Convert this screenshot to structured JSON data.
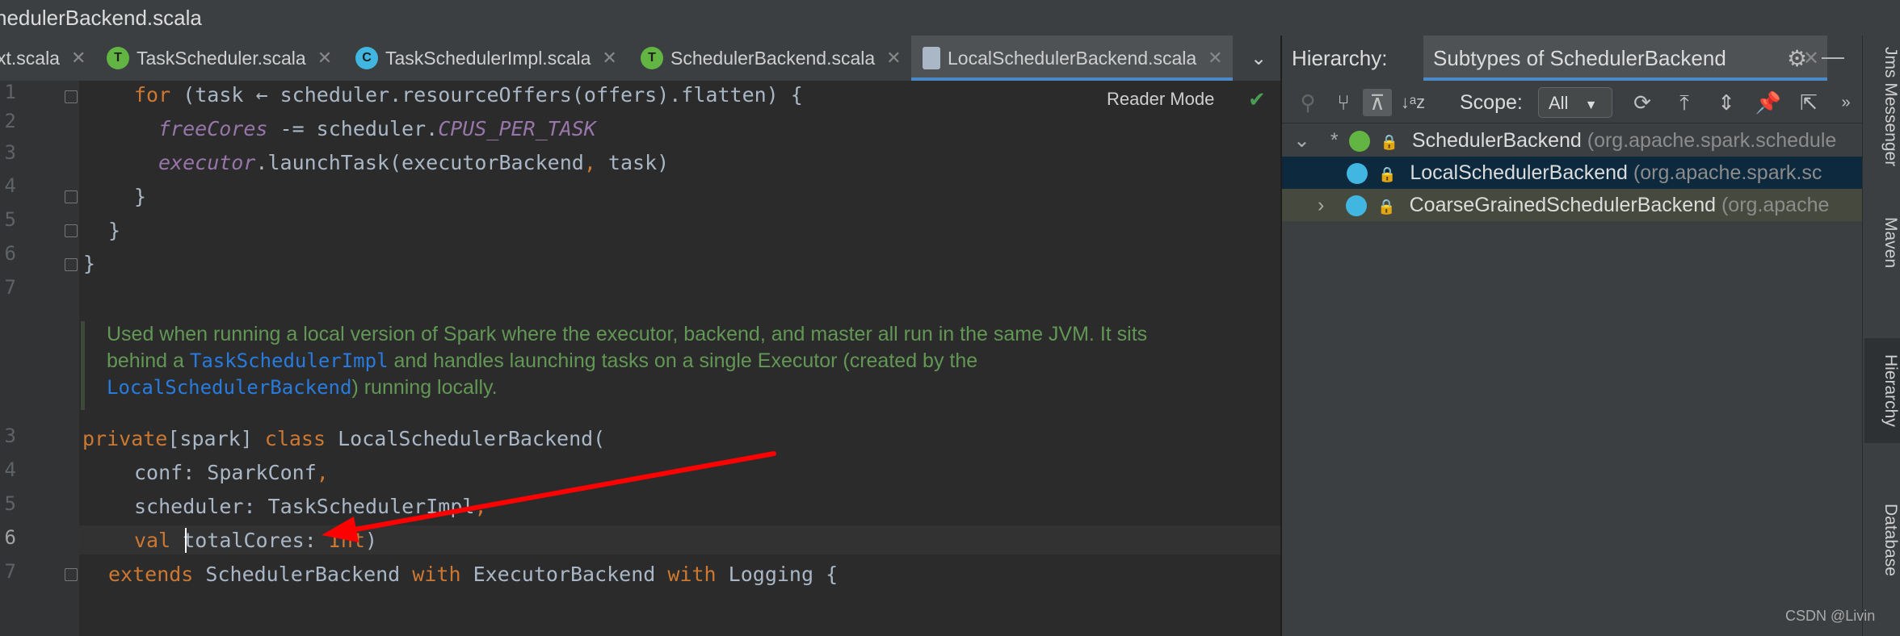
{
  "window": {
    "title": "hedulerBackend.scala"
  },
  "tabs": [
    {
      "label": "xt.scala",
      "icon": "scala-file-icon",
      "active": false
    },
    {
      "label": "TaskScheduler.scala",
      "icon": "trait-icon",
      "active": false
    },
    {
      "label": "TaskSchedulerImpl.scala",
      "icon": "class-icon",
      "active": false
    },
    {
      "label": "SchedulerBackend.scala",
      "icon": "trait-icon",
      "active": false
    },
    {
      "label": "LocalSchedulerBackend.scala",
      "icon": "scala-file-locked-icon",
      "active": true
    }
  ],
  "editor": {
    "reader_mode": "Reader Mode",
    "line_numbers": [
      "1",
      "2",
      "3",
      "4",
      "5",
      "6",
      "7",
      "3",
      "4",
      "5",
      "6",
      "7"
    ],
    "doc_comment": {
      "part1": "Used when running a local version of Spark where the executor, backend, and master all run in the same JVM. It sits behind a ",
      "link1": "TaskSchedulerImpl",
      "part2": " and handles launching tasks on a single Executor (created by the ",
      "link2": "LocalSchedulerBackend",
      "part3": ") running locally."
    }
  },
  "hierarchy": {
    "title": "Hierarchy:",
    "subtab": "Subtypes of SchedulerBackend",
    "scope_label": "Scope:",
    "scope_value": "All",
    "tree": [
      {
        "name": "SchedulerBackend",
        "pkg": "(org.apache.spark.schedule",
        "prefix": "*"
      },
      {
        "name": "LocalSchedulerBackend",
        "pkg": "(org.apache.spark.sc"
      },
      {
        "name": "CoarseGrainedSchedulerBackend",
        "pkg": "(org.apache"
      }
    ]
  },
  "toolstrip": [
    "Jms Messenger",
    "Maven",
    "Hierarchy",
    "Database"
  ],
  "watermark": "CSDN @Livin",
  "colors": {
    "accent": "#4a88c7",
    "arrow": "#ff0000",
    "keyword": "#cc7832",
    "doc": "#629755"
  }
}
